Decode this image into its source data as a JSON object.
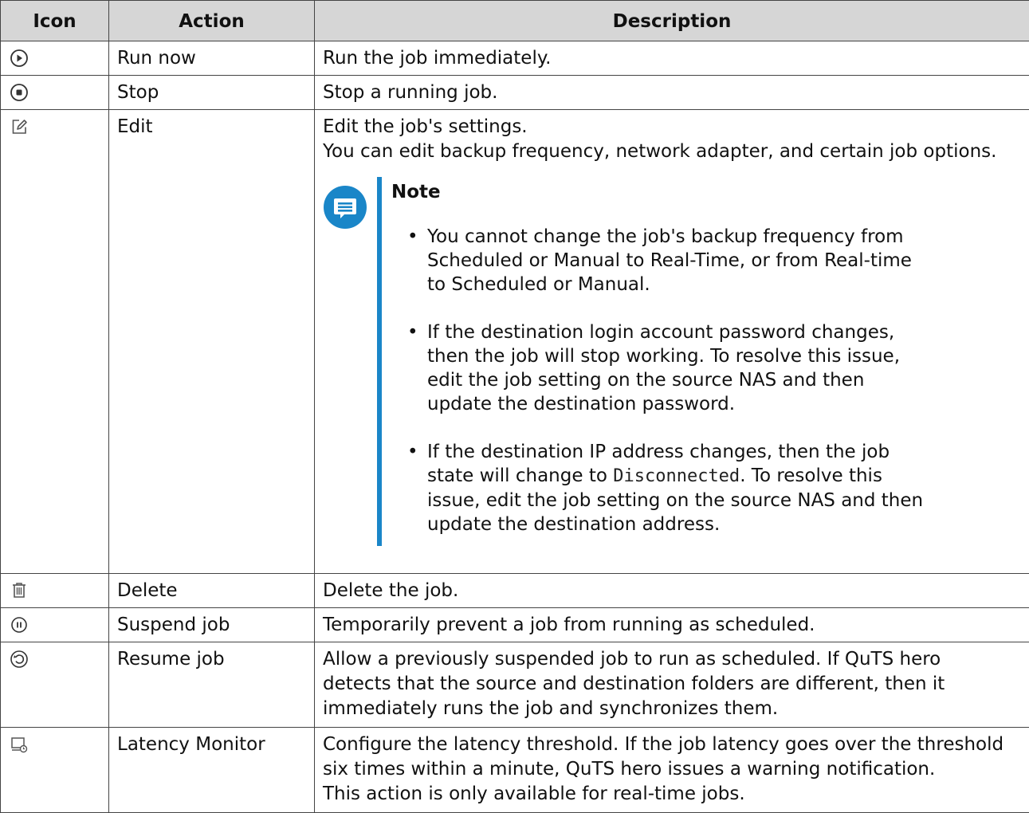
{
  "header": {
    "icon": "Icon",
    "action": "Action",
    "description": "Description"
  },
  "rows": [
    {
      "icon": "play-circle-icon",
      "action": "Run now",
      "lines": [
        "Run the job immediately."
      ]
    },
    {
      "icon": "stop-circle-icon",
      "action": "Stop",
      "lines": [
        "Stop a running job."
      ]
    },
    {
      "icon": "edit-icon",
      "action": "Edit",
      "lines": [
        "Edit the job's settings.",
        "You can edit backup frequency, network adapter, and certain job options."
      ],
      "note": {
        "title": "Note",
        "items": [
          {
            "lines": [
              "You cannot change the job's backup frequency from",
              "Scheduled or Manual to Real-Time, or from Real-time",
              "to Scheduled or Manual."
            ]
          },
          {
            "lines": [
              "If the destination login account password changes,",
              "then the job will stop working. To resolve this issue,",
              "edit the job setting on the source NAS and then",
              "update the destination password."
            ]
          },
          {
            "pre": "If the destination IP address changes, then the job",
            "pre2": "state will change to ",
            "code": "Disconnected",
            "post": ". To resolve this",
            "lines": [
              "issue, edit the job setting on the source NAS and then",
              "update the destination address."
            ]
          }
        ]
      }
    },
    {
      "icon": "trash-icon",
      "action": "Delete",
      "lines": [
        "Delete the job."
      ]
    },
    {
      "icon": "pause-circle-icon",
      "action": "Suspend job",
      "lines": [
        "Temporarily prevent a job from running as scheduled."
      ]
    },
    {
      "icon": "resume-circle-icon",
      "action": "Resume job",
      "lines": [
        "Allow a previously suspended job to run as scheduled. If QuTS hero",
        "detects that the source and destination folders are different, then it",
        "immediately runs the job and synchronizes them."
      ]
    },
    {
      "icon": "latency-monitor-icon",
      "action": "Latency Monitor",
      "lines": [
        "Configure the latency threshold. If the job latency goes over the threshold",
        "six times within a minute, QuTS hero issues a warning notification.",
        "This action is only available for real-time jobs."
      ]
    }
  ],
  "colors": {
    "header_bg": "#d6d6d6",
    "note_accent": "#1a86c8",
    "border": "#444444"
  }
}
